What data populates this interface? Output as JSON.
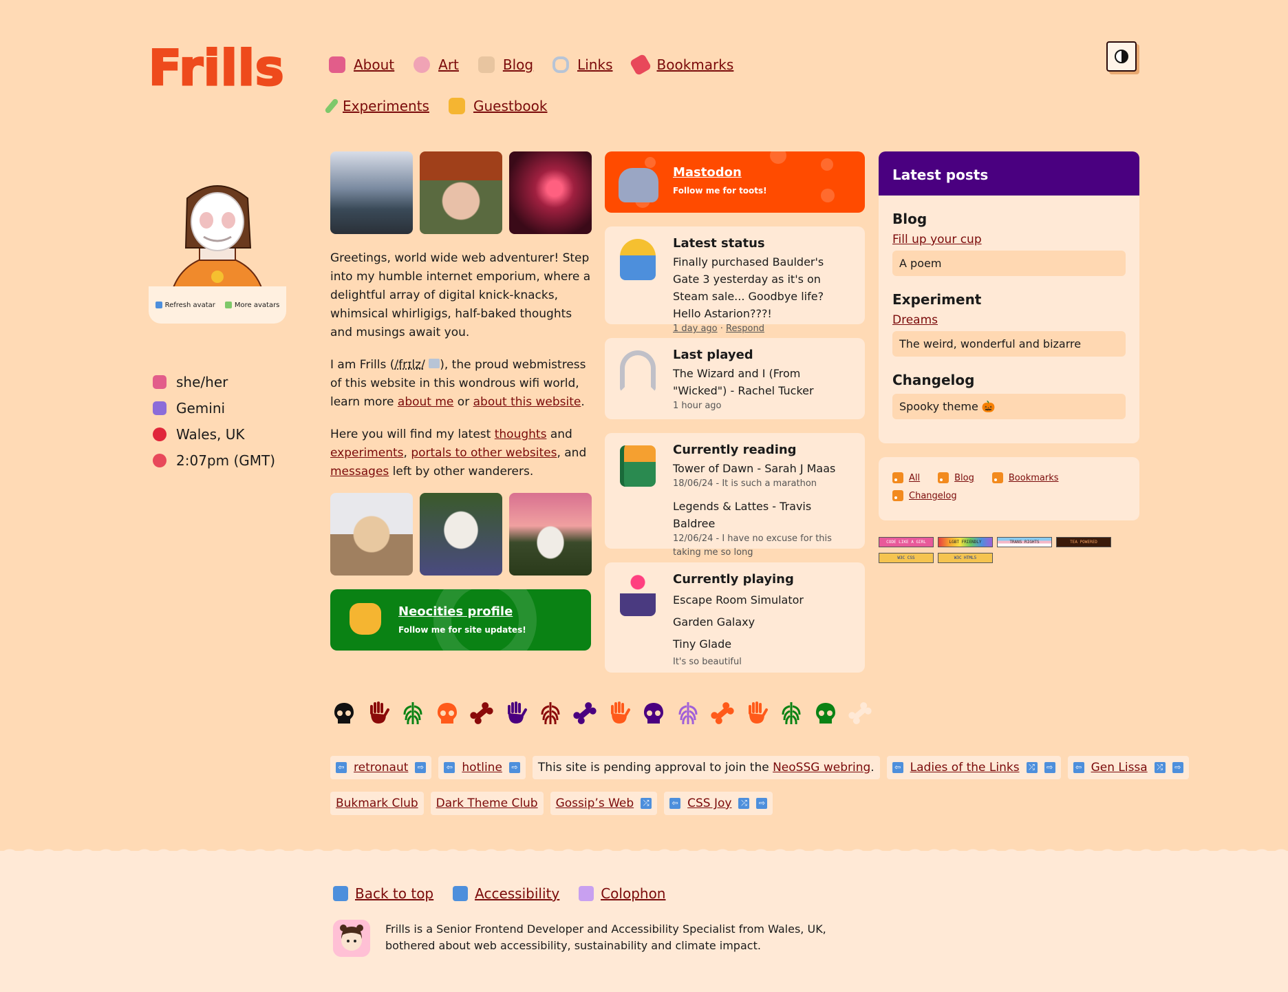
{
  "site": {
    "logo": "Frills"
  },
  "nav": {
    "row1": [
      {
        "label": "About",
        "icon": "tulip-icon",
        "color": "#e25d8a"
      },
      {
        "label": "Art",
        "icon": "palette-icon",
        "color": "#f0a3b5"
      },
      {
        "label": "Blog",
        "icon": "memo-icon",
        "color": "#e8c5a0"
      },
      {
        "label": "Links",
        "icon": "link-icon",
        "color": "#b7c4d6"
      },
      {
        "label": "Bookmarks",
        "icon": "bookmark-icon",
        "color": "#e8485a"
      }
    ],
    "row2": [
      {
        "label": "Experiments",
        "icon": "test-tube-icon",
        "color": "#7ec86a"
      },
      {
        "label": "Guestbook",
        "icon": "waving-hand-icon",
        "color": "#f5b531"
      }
    ]
  },
  "avatar": {
    "refresh_label": "Refresh avatar",
    "more_label": "More avatars"
  },
  "facts": [
    {
      "text": "she/her",
      "icon": "tulip-icon",
      "color": "#e25d8a"
    },
    {
      "text": "Gemini",
      "icon": "gemini-icon",
      "color": "#8b6cd9"
    },
    {
      "text": "Wales, UK",
      "icon": "pin-icon",
      "color": "#e0263a"
    },
    {
      "text": "2:07pm (GMT)",
      "icon": "alarm-clock-icon",
      "color": "#e8485a"
    }
  ],
  "intro": {
    "p1": "Greetings, world wide web adventurer! Step into my humble internet emporium, where a delightful array of digital knick-knacks, whimsical whirligigs, half-baked thoughts and musings await you.",
    "p2_a": "I am Frills (",
    "p2_pron": "/frɪlz/",
    "p2_b": "), the proud webmistress of this website in this wondrous wifi world, learn more ",
    "p2_link1": "about me",
    "p2_c": " or ",
    "p2_link2": "about this website",
    "p2_d": ".",
    "p3_a": "Here you will find my latest ",
    "p3_link1": "thoughts",
    "p3_b": " and ",
    "p3_link2": "experiments",
    "p3_c": ", ",
    "p3_link3": "portals to other websites",
    "p3_d": ", and ",
    "p3_link4": "messages",
    "p3_e": " left by other wanderers."
  },
  "neocities": {
    "title": "Neocities profile",
    "subtitle": "Follow me for site updates!"
  },
  "mastodon": {
    "title": "Mastodon",
    "subtitle": "Follow me for toots!"
  },
  "status": {
    "title": "Latest status",
    "text": "Finally purchased Baulder's Gate 3 yesterday as it's on Steam sale... Goodbye life? Hello Astarion???!",
    "time": "1 day ago",
    "sep": " · ",
    "respond": "Respond"
  },
  "played": {
    "title": "Last played",
    "text": "The Wizard and I (From \"Wicked\") - Rachel Tucker",
    "time": "1 hour ago"
  },
  "reading": {
    "title": "Currently reading",
    "books": [
      {
        "title": "Tower of Dawn - Sarah J Maas",
        "note": "18/06/24 - It is such a marathon"
      },
      {
        "title": "Legends & Lattes - Travis Baldree",
        "note": "12/06/24 - I have no excuse for this taking me so long"
      }
    ]
  },
  "playing": {
    "title": "Currently playing",
    "games": [
      "Escape Room Simulator",
      "Garden Galaxy",
      "Tiny Glade"
    ],
    "note": "It's so beautiful"
  },
  "posts": {
    "header": "Latest posts",
    "sections": [
      {
        "heading": "Blog",
        "link": "Fill up your cup",
        "desc": "A poem"
      },
      {
        "heading": "Experiment",
        "link": "Dreams",
        "desc": "The weird, wonderful and bizarre"
      },
      {
        "heading": "Changelog",
        "link": "",
        "desc": "Spooky theme 🎃"
      }
    ]
  },
  "feeds": [
    "All",
    "Blog",
    "Bookmarks",
    "Changelog"
  ],
  "badges": [
    {
      "text": "CODE LIKE A GIRL",
      "bg": "#e85a9a",
      "fg": "#ffffff"
    },
    {
      "text": "LGBT FRIENDLY",
      "bg": "#8cc870",
      "fg": "#333333"
    },
    {
      "text": "TRANS RIGHTS",
      "bg": "#f5d6e0",
      "fg": "#333333"
    },
    {
      "text": "TEA POWERED",
      "bg": "#3a1a0a",
      "fg": "#f5a060"
    },
    {
      "text": "W3C CSS",
      "bg": "#f5c450",
      "fg": "#1a3a8a"
    },
    {
      "text": "W3C HTML5",
      "bg": "#f5c450",
      "fg": "#1a3a8a"
    }
  ],
  "stickers": [
    {
      "icon": "skull-icon",
      "color": "#111111"
    },
    {
      "icon": "hand-icon",
      "color": "#8a0a0a"
    },
    {
      "icon": "ribcage-icon",
      "color": "#0a8214"
    },
    {
      "icon": "skull-icon",
      "color": "#ff5a1a"
    },
    {
      "icon": "bone-icon",
      "color": "#8a0a0a"
    },
    {
      "icon": "hand-icon",
      "color": "#4a0080"
    },
    {
      "icon": "ribcage-icon",
      "color": "#8a0a0a"
    },
    {
      "icon": "bone-icon",
      "color": "#4a0080"
    },
    {
      "icon": "hand-icon",
      "color": "#ff5a1a"
    },
    {
      "icon": "skull-icon",
      "color": "#4a0080"
    },
    {
      "icon": "ribcage-icon",
      "color": "#a060d8"
    },
    {
      "icon": "bone-icon",
      "color": "#ff5a1a"
    },
    {
      "icon": "hand-icon",
      "color": "#ff5a1a"
    },
    {
      "icon": "ribcage-icon",
      "color": "#0a8214"
    },
    {
      "icon": "skull-icon",
      "color": "#0a8214"
    },
    {
      "icon": "bone-icon",
      "color": "#ffe9d6"
    }
  ],
  "webrings": {
    "retronaut": "retronaut",
    "hotline": "hotline",
    "neossg_a": "This site is pending approval to join the ",
    "neossg_link": "NeoSSG webring",
    "neossg_b": ".",
    "ladies": "Ladies of the Links",
    "genlissa": "Gen Lissa",
    "bukmark": "Bukmark Club",
    "darktheme": "Dark Theme Club",
    "gossip": "Gossip’s Web",
    "cssjoy": "CSS Joy",
    "left_arrow": "⇦",
    "right_arrow": "⇨",
    "shuffle": "⤮"
  },
  "footer": {
    "links": [
      {
        "label": "Back to top",
        "icon": "up-arrow-icon",
        "color": "#4d8fdc"
      },
      {
        "label": "Accessibility",
        "icon": "wheelchair-icon",
        "color": "#4d8fdc"
      },
      {
        "label": "Colophon",
        "icon": "technologist-icon",
        "color": "#c8a0f0"
      }
    ],
    "about": "Frills is a Senior Frontend Developer and Accessibility Specialist from Wales, UK, bothered about web accessibility, sustainability and climate impact."
  },
  "colors": {
    "background": "#ffdab5",
    "card": "#ffe9d6",
    "link": "#7a0a0a",
    "logo": "#ee4a1c",
    "mastodon": "#ff4b00",
    "neocities": "#0a8214",
    "posts_header": "#4a0080"
  }
}
